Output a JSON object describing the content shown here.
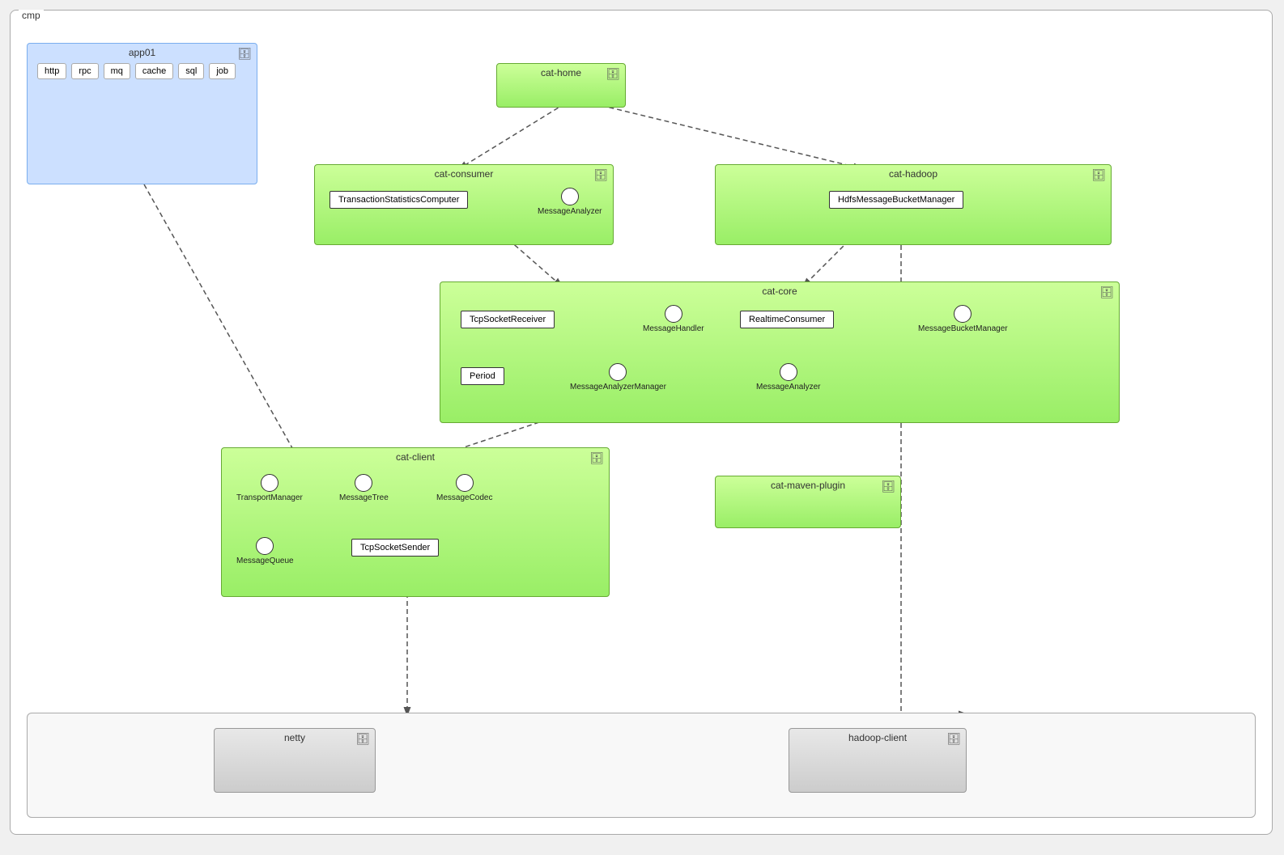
{
  "diagram": {
    "cmp_label": "cmp",
    "app01": {
      "title": "app01",
      "items": [
        "http",
        "rpc",
        "mq",
        "cache",
        "sql",
        "job"
      ]
    },
    "cat_home": {
      "title": "cat-home"
    },
    "cat_consumer": {
      "title": "cat-consumer",
      "rect_items": [
        "TransactionStatisticsComputer"
      ],
      "circle_items": [
        "MessageAnalyzer"
      ]
    },
    "cat_hadoop": {
      "title": "cat-hadoop",
      "rect_items": [
        "HdfsMessageBucketManager"
      ],
      "circle_items": []
    },
    "cat_core": {
      "title": "cat-core",
      "rect_items": [
        "TcpSocketReceiver",
        "RealtimeConsumer",
        "Period"
      ],
      "circle_items": [
        "MessageHandler",
        "MessageBucketManager",
        "MessageAnalyzerManager",
        "MessageAnalyzer"
      ]
    },
    "cat_client": {
      "title": "cat-client",
      "rect_items": [
        "TcpSocketSender"
      ],
      "circle_items": [
        "TransportManager",
        "MessageTree",
        "MessageCodec",
        "MessageQueue"
      ]
    },
    "cat_maven_plugin": {
      "title": "cat-maven-plugin"
    },
    "netty": {
      "title": "netty"
    },
    "hadoop_client": {
      "title": "hadoop-client"
    },
    "icons": {
      "component": "🗄"
    }
  }
}
